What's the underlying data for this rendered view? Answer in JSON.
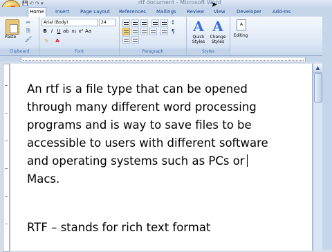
{
  "window": {
    "title": "rtf document - Microsoft Word"
  },
  "tabs": [
    "Home",
    "Insert",
    "Page Layout",
    "References",
    "Mailings",
    "Review",
    "View",
    "Developer",
    "Add-Ins"
  ],
  "active_tab": "Home",
  "ribbon": {
    "clipboard": {
      "paste_label": "Paste",
      "group_label": "Clipboard"
    },
    "font": {
      "font_name": "Arial (Body)",
      "font_size": "24",
      "group_label": "Font"
    },
    "paragraph": {
      "group_label": "Paragraph"
    },
    "styles": {
      "quick_label": "Quick",
      "quick_sub": "Styles",
      "change_label": "Change",
      "change_sub": "Styles",
      "group_label": "Styles"
    },
    "editing": {
      "label": "Editing"
    }
  },
  "document": {
    "paragraph1_lines": [
      "An rtf is a file type that can be opened",
      "through many different word processing",
      "programs and is way to save files to be",
      "accessible to users with different software",
      "and operating systems such as PCs or",
      "Macs."
    ],
    "paragraph2": "RTF – stands for rich text format"
  },
  "colors": {
    "accent": "#15428b",
    "ribbon_bg": "#dce7f5"
  }
}
